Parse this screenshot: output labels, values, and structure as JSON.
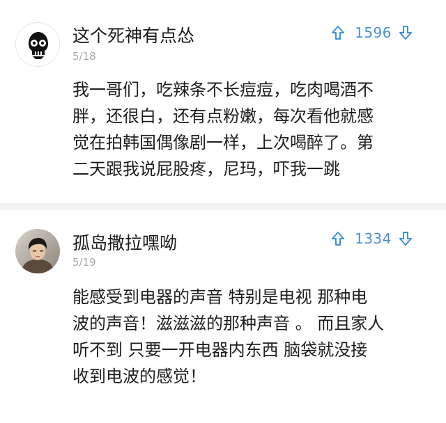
{
  "comments": [
    {
      "username": "这个死神有点怂",
      "date": "5/18",
      "votes": "1596",
      "lines": [
        "我一哥们，吃辣条不长痘痘，吃肉喝酒不",
        "胖，还很白，还有点粉嫩，每次看他就感",
        "觉在拍韩国偶像剧一样，上次喝醉了。第",
        "二天跟我说屁股疼，尼玛，吓我一跳"
      ]
    },
    {
      "username": "孤岛撒拉嘿呦",
      "date": "5/19",
      "votes": "1334",
      "lines": [
        "能感受到电器的声音 特别是电视  那种电",
        "波的声音！滋滋滋的那种声音 。 而且家人",
        "听不到  只要一开电器内东西 脑袋就没接",
        "收到电波的感觉！"
      ]
    }
  ],
  "colors": {
    "accent": "#3e8fe0",
    "date": "#a8a8a8",
    "separator": "#f2f2f2"
  },
  "icons": {
    "upvote": "arrow-up-icon",
    "downvote": "arrow-down-icon",
    "avatar1": "skull-avatar",
    "avatar2": "person-photo-avatar"
  }
}
